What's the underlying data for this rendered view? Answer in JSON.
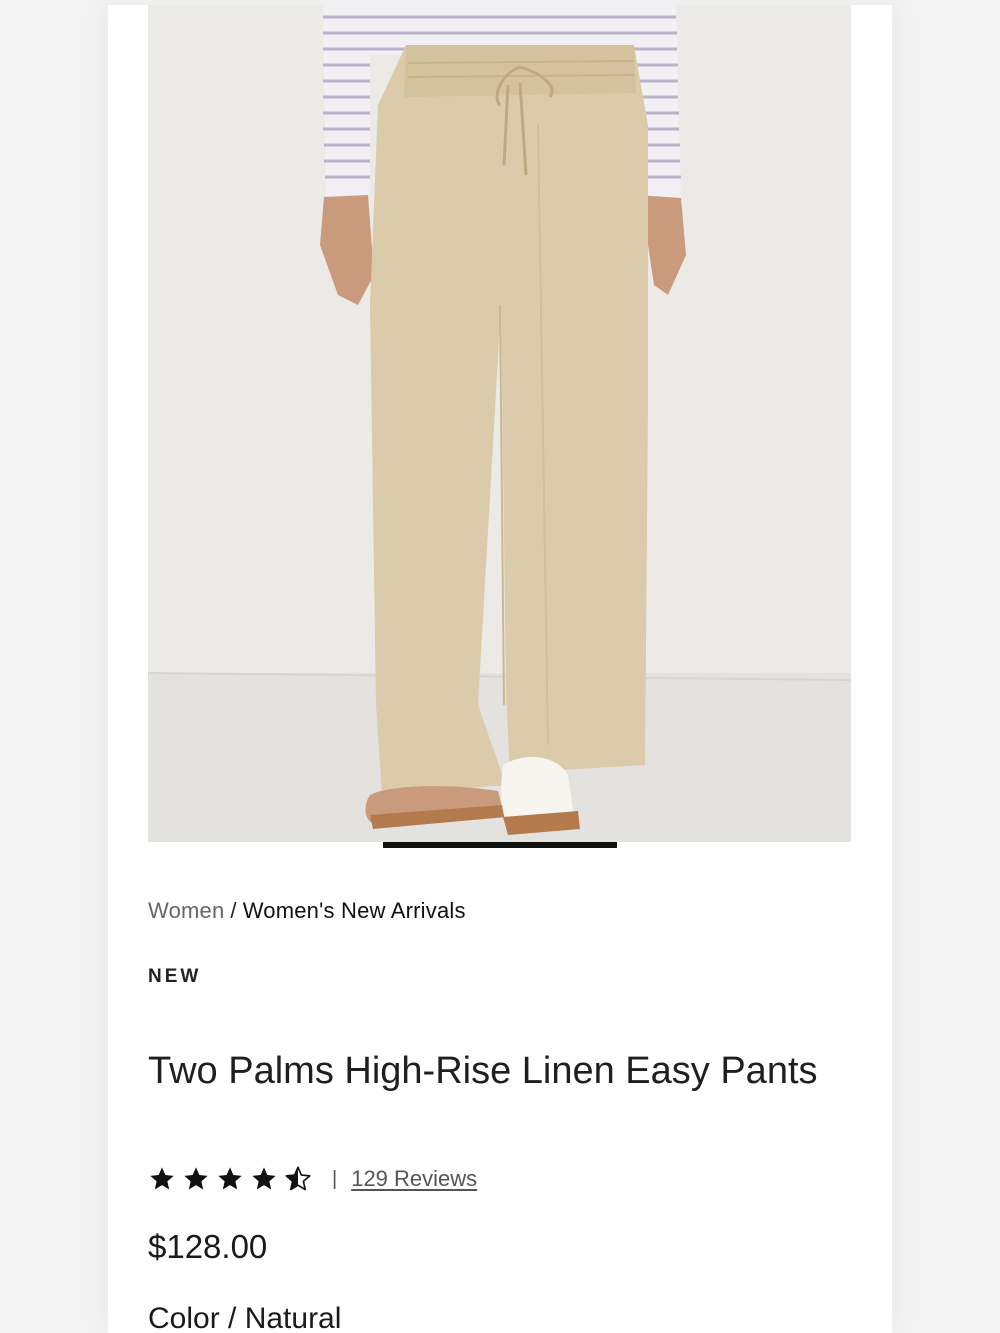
{
  "product_image": {
    "alt": "Two Palms High-Rise Linen Easy Pants",
    "background_color": "#ebeae7",
    "pants_color": "#dccbaa"
  },
  "gallery_progress": 0.33,
  "breadcrumb": {
    "parent": "Women",
    "separator": "/",
    "current": "Women's New Arrivals"
  },
  "badge": "NEW",
  "product": {
    "title": "Two Palms High-Rise Linen Easy Pants",
    "rating": 4.5,
    "rating_max": 5,
    "rating_divider": "|",
    "reviews_label": "129 Reviews",
    "price": "$128.00",
    "color_label": "Color / Natural"
  },
  "icons": {
    "star_full": "star-filled-icon",
    "star_half": "star-half-icon"
  },
  "colors": {
    "text": "#1a1a1a",
    "muted": "#666666",
    "star": "#111111"
  }
}
